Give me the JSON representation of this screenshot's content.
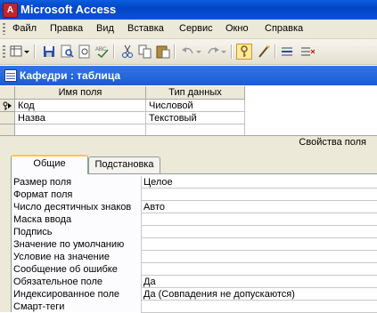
{
  "app": {
    "title": "Microsoft Access",
    "icon": "access-key-icon"
  },
  "menu": {
    "items": [
      "Файл",
      "Правка",
      "Вид",
      "Вставка",
      "Сервис",
      "Окно",
      "Справка"
    ]
  },
  "toolbar": {
    "buttons": [
      "view-icon",
      "save-icon",
      "search-icon",
      "print-preview-icon",
      "spelling-icon",
      "cut-icon",
      "copy-icon",
      "paste-icon",
      "undo-icon",
      "redo-icon",
      "primary-key-icon",
      "builder-icon",
      "insert-rows-icon",
      "delete-rows-icon"
    ],
    "primary_key_active": true
  },
  "window": {
    "title": "Кафедри : таблица"
  },
  "grid": {
    "headers": [
      "Имя поля",
      "Тип данных"
    ],
    "rows": [
      {
        "name": "Код",
        "type": "Числовой",
        "primary_key": true
      },
      {
        "name": "Назва",
        "type": "Текстовый",
        "primary_key": false
      }
    ]
  },
  "properties": {
    "caption": "Свойства поля",
    "tabs": [
      "Общие",
      "Подстановка"
    ],
    "active_tab": "Общие",
    "rows": [
      {
        "label": "Размер поля",
        "value": "Целое"
      },
      {
        "label": "Формат поля",
        "value": ""
      },
      {
        "label": "Число десятичных знаков",
        "value": "Авто"
      },
      {
        "label": "Маска ввода",
        "value": ""
      },
      {
        "label": "Подпись",
        "value": ""
      },
      {
        "label": "Значение по умолчанию",
        "value": ""
      },
      {
        "label": "Условие на значение",
        "value": ""
      },
      {
        "label": "Сообщение об ошибке",
        "value": ""
      },
      {
        "label": "Обязательное поле",
        "value": "Да"
      },
      {
        "label": "Индексированное поле",
        "value": "Да (Совпадения не допускаются)"
      },
      {
        "label": "Смарт-теги",
        "value": ""
      }
    ]
  },
  "colors": {
    "title_bar": "#0a52d8",
    "window_bar": "#1d5ad6",
    "active_tab_accent": "#ffc83c",
    "toolbar_active": "#ffe9a0"
  }
}
